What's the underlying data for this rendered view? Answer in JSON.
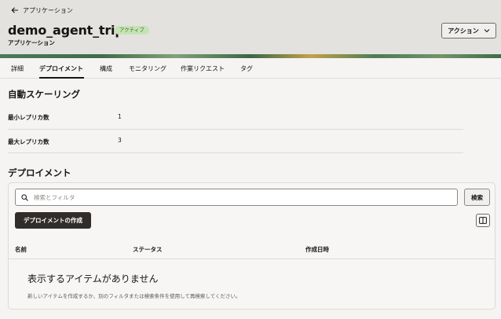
{
  "header": {
    "back_label": "アプリケーション",
    "title": "demo_agent_trip",
    "status_badge": "アクティブ",
    "subtitle": "アプリケーション",
    "actions_label": "アクション",
    "status_color": "#c7e3b5"
  },
  "tabs": [
    {
      "label": "詳細",
      "active": false
    },
    {
      "label": "デプロイメント",
      "active": true
    },
    {
      "label": "構成",
      "active": false
    },
    {
      "label": "モニタリング",
      "active": false
    },
    {
      "label": "作業リクエスト",
      "active": false
    },
    {
      "label": "タグ",
      "active": false
    }
  ],
  "autoscaling": {
    "title": "自動スケーリング",
    "properties": [
      {
        "label": "最小レプリカ数",
        "value": "1"
      },
      {
        "label": "最大レプリカ数",
        "value": "3"
      }
    ]
  },
  "deployments": {
    "title": "デプロイメント",
    "search_placeholder": "検索とフィルタ",
    "search_value": "",
    "search_button": "検索",
    "create_button": "デプロイメントの作成",
    "columns": [
      "名前",
      "ステータス",
      "作成日時"
    ],
    "empty_title": "表示するアイテムがありません",
    "empty_description": "新しいアイテムを作成するか、別のフィルタまたは検索条件を使用して再検索してください。"
  },
  "icons": {
    "back": "arrow-left-icon",
    "actions": "chevron-down-icon",
    "search": "search-icon",
    "columns": "columns-icon"
  }
}
